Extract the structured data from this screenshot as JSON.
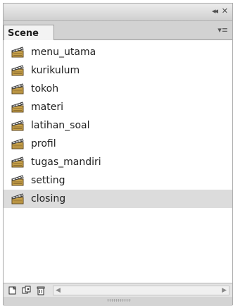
{
  "window": {
    "collapse_glyph": "◂◂",
    "close_glyph": "✕"
  },
  "tab": {
    "label": "Scene",
    "menu_glyph": "▾≡"
  },
  "scenes": [
    {
      "label": "menu_utama",
      "selected": false
    },
    {
      "label": "kurikulum",
      "selected": false
    },
    {
      "label": "tokoh",
      "selected": false
    },
    {
      "label": "materi",
      "selected": false
    },
    {
      "label": "latihan_soal",
      "selected": false
    },
    {
      "label": "profil",
      "selected": false
    },
    {
      "label": "tugas_mandiri",
      "selected": false
    },
    {
      "label": "setting",
      "selected": false
    },
    {
      "label": "closing",
      "selected": true
    }
  ],
  "toolbar": {
    "icons": [
      "add-scene-icon",
      "duplicate-scene-icon",
      "delete-scene-icon"
    ]
  },
  "scrollbar": {
    "left_arrow": "◀",
    "right_arrow": "▶"
  },
  "colors": {
    "selected_row": "#dcdcdc",
    "panel_chrome": "#d4d4d4"
  }
}
